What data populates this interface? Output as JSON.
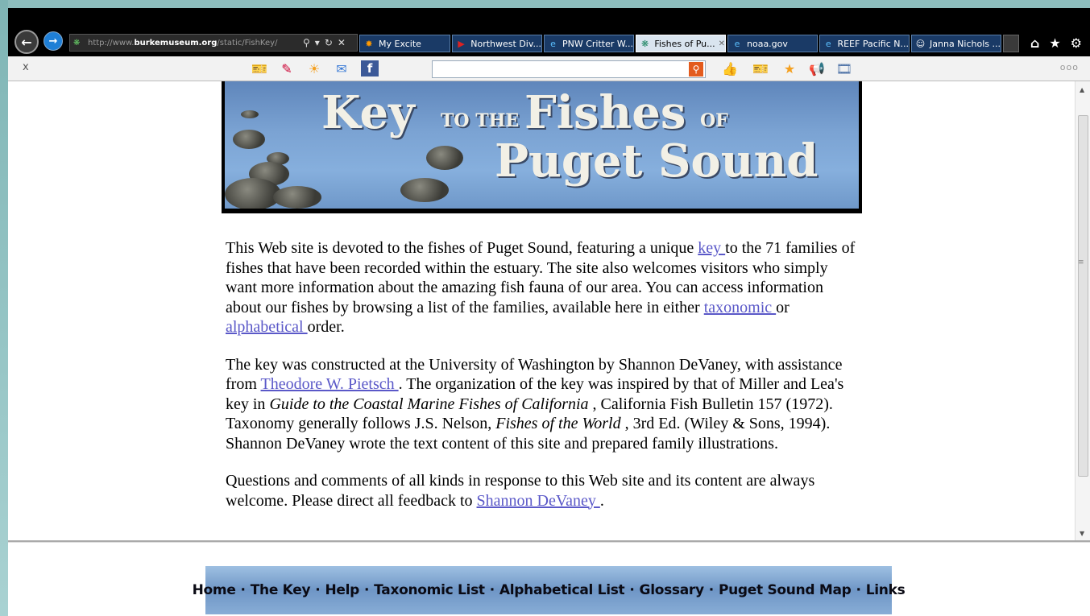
{
  "browser": {
    "address": {
      "prefix": "http://www.",
      "domain": "burkemuseum.org",
      "path": "/static/FishKey/"
    },
    "tabs": [
      {
        "label": "My Excite",
        "icon": "excite-icon"
      },
      {
        "label": "Northwest Div...",
        "icon": "flag-icon"
      },
      {
        "label": "PNW Critter W...",
        "icon": "ie-icon"
      },
      {
        "label": "Fishes of Pu...",
        "icon": "fish-icon",
        "active": true
      },
      {
        "label": "noaa.gov",
        "icon": "ie-icon"
      },
      {
        "label": "REEF Pacific N...",
        "icon": "ie-icon"
      },
      {
        "label": "Janna Nichols ...",
        "icon": "smiley-icon"
      }
    ]
  },
  "toolbar": {
    "close_label": "x",
    "more_label": "ooo"
  },
  "banner": {
    "key": "Key",
    "to_the": "TO THE",
    "fishes": "Fishes",
    "of": "OF",
    "puget_sound": "Puget Sound"
  },
  "article": {
    "p1": {
      "a": "This Web site is devoted to the fishes of Puget Sound, featuring a unique ",
      "link_key": "key ",
      "b": "to the 71 families of fishes that have been recorded within the estuary. The site also welcomes visitors who simply want more information about the amazing fish fauna of our area. You can access information about our fishes by browsing a list of the families, available here in either ",
      "link_taxonomic": "taxonomic ",
      "c": "or ",
      "link_alphabetical": "alphabetical ",
      "d": "order."
    },
    "p2": {
      "a": "The key was constructed at the University of Washington by Shannon DeVaney, with assistance from ",
      "link_pietsch": "Theodore W. Pietsch ",
      "b": ". The organization of the key was inspired by that of Miller and Lea's key in ",
      "italic_guide": "Guide to the Coastal Marine Fishes of California",
      "c": " , California Fish Bulletin 157 (1972). Taxonomy generally follows J.S. Nelson, ",
      "italic_fishes": "Fishes of the World",
      "d": " , 3rd Ed. (Wiley & Sons, 1994). Shannon DeVaney wrote the text content of this site and prepared family illustrations."
    },
    "p3": {
      "a": "Questions and comments of all kinds in response to this Web site and its content are always welcome. Please direct all feedback to ",
      "link_devaney": "Shannon DeVaney ",
      "b": "."
    }
  },
  "nav": {
    "separator": "·",
    "items": [
      "Home",
      "The Key",
      "Help",
      "Taxonomic List",
      "Alphabetical List",
      "Glossary",
      "Puget Sound Map",
      "Links"
    ]
  }
}
